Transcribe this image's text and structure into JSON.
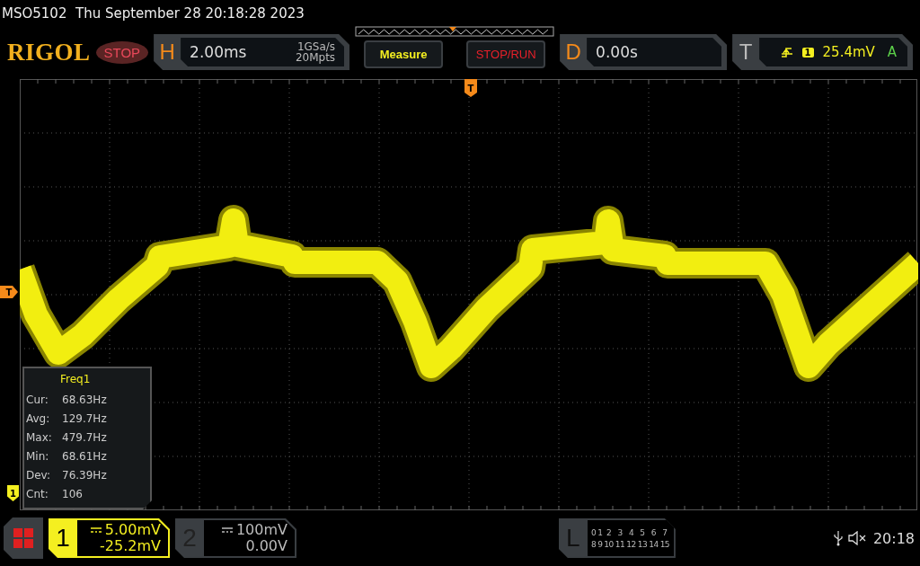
{
  "header": {
    "model": "MSO5102",
    "datetime": "Thu September 28 20:18:28 2023"
  },
  "brand": "RIGOL",
  "run_status": "STOP",
  "horizontal": {
    "label": "H",
    "timebase": "2.00ms",
    "sample_rate": "1GSa/s",
    "memory_depth": "20Mpts"
  },
  "buttons": [
    {
      "label": "Measure",
      "kind": "measure"
    },
    {
      "label": "STOP/RUN",
      "kind": "run"
    }
  ],
  "delay": {
    "label": "D",
    "value": "0.00s"
  },
  "trigger": {
    "label": "T",
    "source": "1",
    "level": "25.4mV",
    "mode": "A"
  },
  "markers": {
    "trigger_position": "T",
    "trigger_level": "T",
    "channel": "1"
  },
  "measurement": {
    "title": "Freq1",
    "rows": [
      {
        "label": "Cur:",
        "value": "68.63Hz"
      },
      {
        "label": "Avg:",
        "value": "129.7Hz"
      },
      {
        "label": "Max:",
        "value": "479.7Hz"
      },
      {
        "label": "Min:",
        "value": "68.61Hz"
      },
      {
        "label": "Dev:",
        "value": "76.39Hz"
      },
      {
        "label": "Cnt:",
        "value": "106"
      }
    ]
  },
  "channels": [
    {
      "number": "1",
      "scale": "5.00mV",
      "offset": "-25.2mV",
      "on": true
    },
    {
      "number": "2",
      "scale": "100mV",
      "offset": "0.00V",
      "on": false
    }
  ],
  "logic": {
    "label": "L",
    "rows": [
      [
        "0",
        "1",
        "2",
        "3",
        "4",
        "5",
        "6",
        "7"
      ],
      [
        "8",
        "9",
        "10",
        "11",
        "12",
        "13",
        "14",
        "15"
      ]
    ]
  },
  "status": {
    "time": "20:18"
  }
}
